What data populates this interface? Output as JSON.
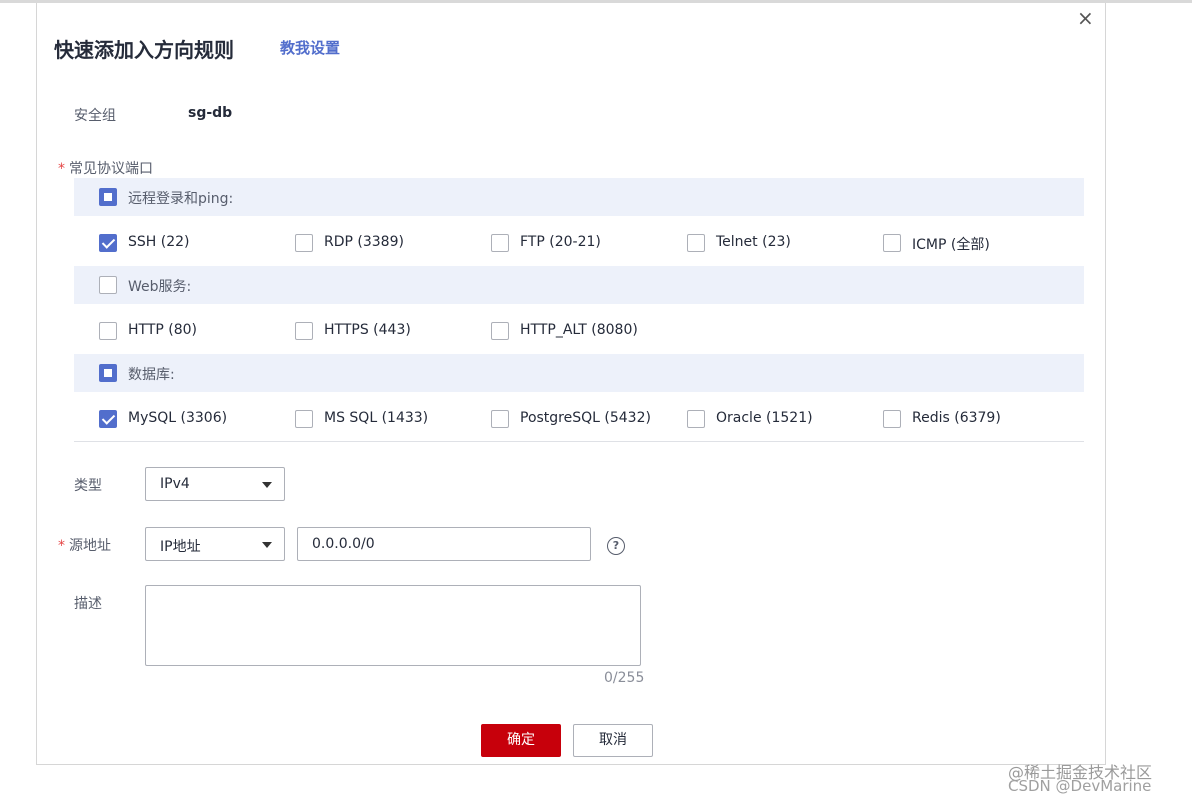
{
  "dialog": {
    "title": "快速添加入方向规则",
    "help_link": "教我设置",
    "close_symbol": "×"
  },
  "security_group": {
    "label": "安全组",
    "value": "sg-db"
  },
  "ports": {
    "label": "常见协议端口",
    "required_mark": "*",
    "groups": [
      {
        "label": "远程登录和ping:",
        "state": "indeterminate",
        "items": [
          {
            "label": "SSH (22)",
            "checked": true
          },
          {
            "label": "RDP (3389)",
            "checked": false
          },
          {
            "label": "FTP (20-21)",
            "checked": false
          },
          {
            "label": "Telnet (23)",
            "checked": false
          },
          {
            "label": "ICMP (全部)",
            "checked": false
          }
        ]
      },
      {
        "label": "Web服务:",
        "state": "unchecked",
        "items": [
          {
            "label": "HTTP (80)",
            "checked": false
          },
          {
            "label": "HTTPS (443)",
            "checked": false
          },
          {
            "label": "HTTP_ALT (8080)",
            "checked": false
          }
        ]
      },
      {
        "label": "数据库:",
        "state": "indeterminate",
        "items": [
          {
            "label": "MySQL (3306)",
            "checked": true
          },
          {
            "label": "MS SQL (1433)",
            "checked": false
          },
          {
            "label": "PostgreSQL (5432)",
            "checked": false
          },
          {
            "label": "Oracle (1521)",
            "checked": false
          },
          {
            "label": "Redis (6379)",
            "checked": false
          }
        ]
      }
    ]
  },
  "type_field": {
    "label": "类型",
    "value": "IPv4"
  },
  "source_field": {
    "label": "源地址",
    "required_mark": "*",
    "select_value": "IP地址",
    "input_value": "0.0.0.0/0",
    "help_icon": "?"
  },
  "description_field": {
    "label": "描述",
    "value": "",
    "counter": "0/255"
  },
  "buttons": {
    "confirm": "确定",
    "cancel": "取消"
  },
  "watermark": {
    "line1": "@稀土掘金技术社区",
    "line2": "CSDN @DevMarine"
  },
  "colors": {
    "accent": "#526ecc",
    "primary_button": "#c7000b",
    "group_background": "#edf1fa",
    "required": "#e54545"
  }
}
